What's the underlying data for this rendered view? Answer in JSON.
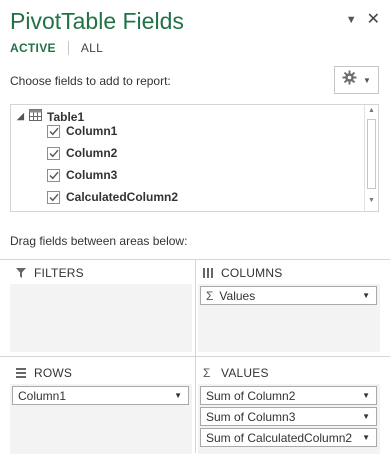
{
  "panel": {
    "title": "PivotTable Fields",
    "tabs": {
      "active": "ACTIVE",
      "all": "ALL"
    },
    "choose_label": "Choose fields to add to report:",
    "drag_label": "Drag fields between areas below:"
  },
  "fields": {
    "table_name": "Table1",
    "items": [
      {
        "label": "Column1",
        "checked": true
      },
      {
        "label": "Column2",
        "checked": true
      },
      {
        "label": "Column3",
        "checked": true
      },
      {
        "label": "CalculatedColumn2",
        "checked": true
      }
    ]
  },
  "areas": {
    "filters": {
      "title": "FILTERS"
    },
    "columns": {
      "title": "COLUMNS",
      "items": [
        "Values"
      ]
    },
    "rows": {
      "title": "ROWS",
      "items": [
        "Column1"
      ]
    },
    "values": {
      "title": "VALUES",
      "items": [
        "Sum of Column2",
        "Sum of Column3",
        "Sum of CalculatedColumn2"
      ]
    }
  },
  "icons": {
    "collapse": "chevron-down-icon",
    "close": "close-icon",
    "settings": "gear-icon",
    "table": "table-icon",
    "filter": "funnel-icon",
    "columns": "columns-icon",
    "rows": "rows-icon",
    "values": "sigma-icon"
  },
  "colors": {
    "accent": "#217346",
    "border": "#d6d6d6",
    "area_bg": "#f3f3f3"
  }
}
